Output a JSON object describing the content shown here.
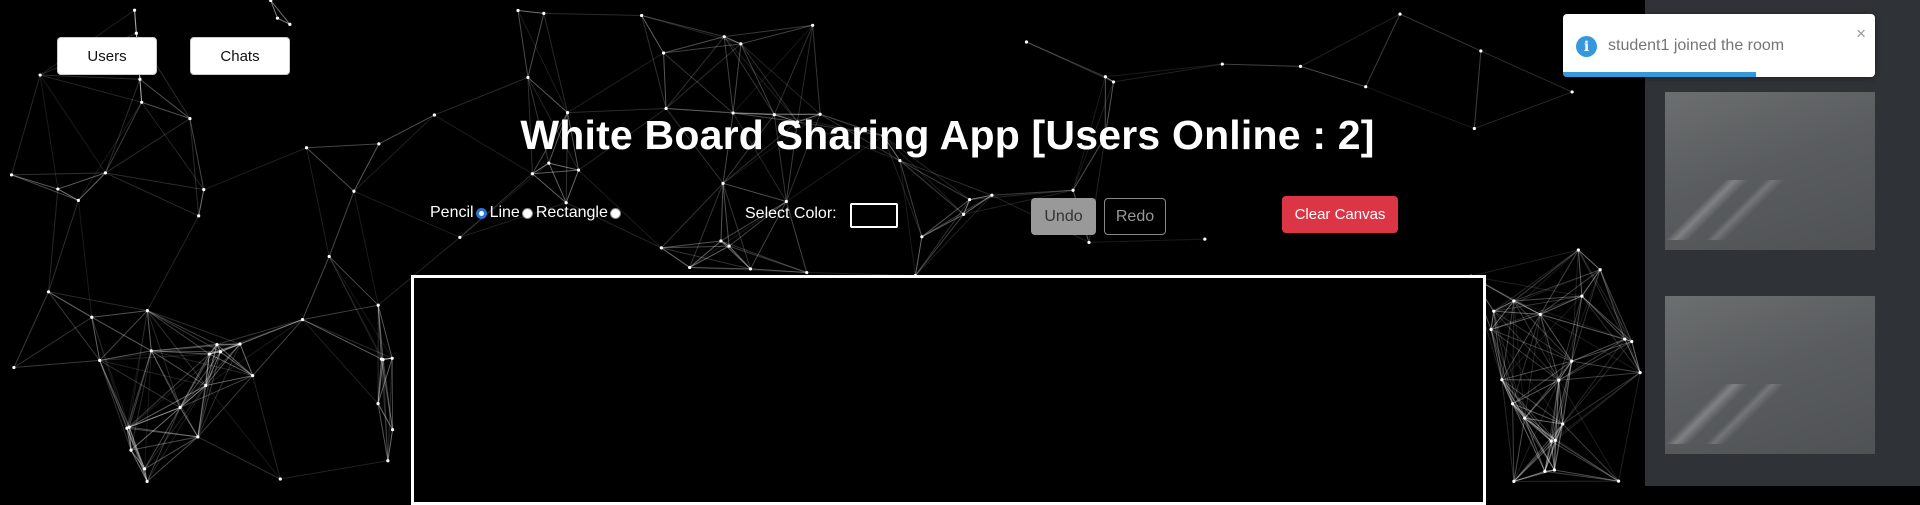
{
  "nav": {
    "users_label": "Users",
    "chats_label": "Chats"
  },
  "header": {
    "title": "White Board Sharing App [Users Online : 2]"
  },
  "tools": {
    "options": [
      {
        "label": "Pencil",
        "checked": true
      },
      {
        "label": "Line",
        "checked": false
      },
      {
        "label": "Rectangle",
        "checked": false
      }
    ],
    "color_label": "Select Color:",
    "selected_color": "#000000",
    "undo_label": "Undo",
    "redo_label": "Redo",
    "clear_label": "Clear Canvas"
  },
  "toast": {
    "message": "student1 joined the room",
    "close_glyph": "×",
    "icon_glyph": "i",
    "progress_fraction": 0.62,
    "accent": "#3498db"
  },
  "colors": {
    "danger": "#dc3545",
    "sidebar": "#2f3337",
    "background": "#000000"
  }
}
